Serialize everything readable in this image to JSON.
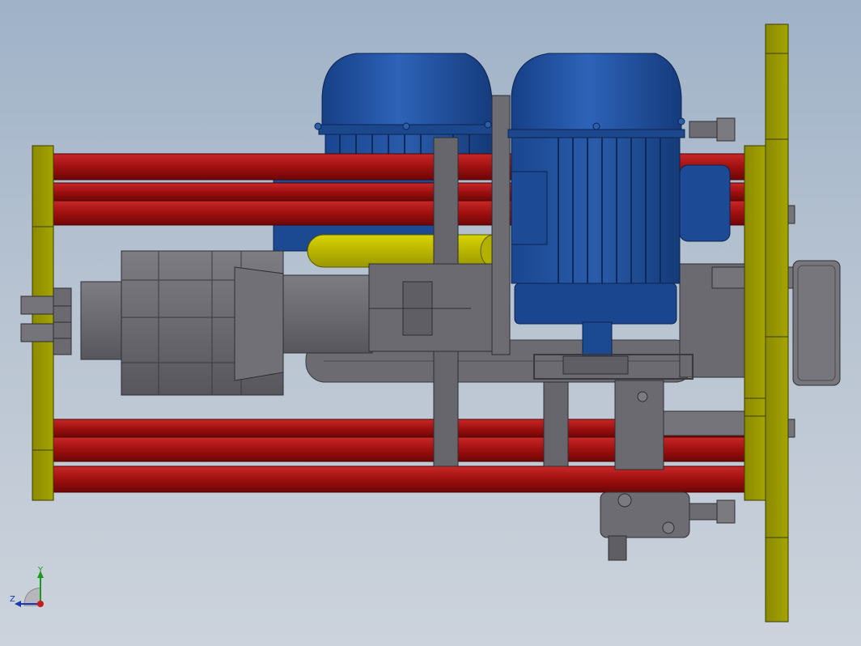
{
  "triad": {
    "y_label": "Y",
    "z_label": "Z"
  },
  "colors": {
    "background_top": "#9fb2c8",
    "background_bottom": "#ccd3dc",
    "rod_red": "#b01515",
    "plate_yellow": "#9a9a00",
    "motor_blue": "#1f4f9a",
    "steel_grey": "#6e6e74",
    "tank_yellow": "#c8c400",
    "axis_y": "#1a9a1a",
    "axis_z": "#1a3ab0",
    "axis_x": "#c81a1a"
  },
  "model": {
    "components": [
      "tie-rod",
      "end-plate",
      "flange-plate",
      "electric-motor",
      "pump-body",
      "reservoir-tank",
      "mounting-bracket",
      "hex-bolt"
    ]
  }
}
